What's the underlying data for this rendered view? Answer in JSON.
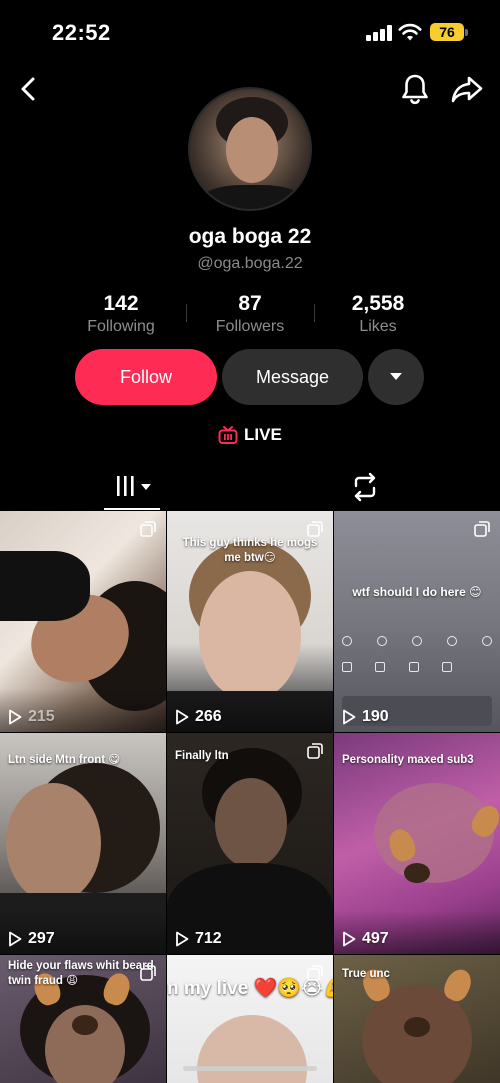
{
  "status_bar": {
    "time": "22:52",
    "battery": "76"
  },
  "header": {
    "back_icon": "chevron-left-icon",
    "bell_icon": "bell-icon",
    "share_icon": "share-arrow-icon"
  },
  "profile": {
    "display_name": "oga boga 22",
    "username": "@oga.boga.22"
  },
  "stats": [
    {
      "value": "142",
      "label": "Following"
    },
    {
      "value": "87",
      "label": "Followers"
    },
    {
      "value": "2,558",
      "label": "Likes"
    }
  ],
  "actions": {
    "follow": "Follow",
    "message": "Message",
    "more_icon": "caret-down-icon"
  },
  "live": {
    "label": "LIVE",
    "icon": "tv-icon"
  },
  "tabs": {
    "videos_icon": "grid-bars-icon",
    "reposts_icon": "repost-icon"
  },
  "videos": [
    {
      "views": "215",
      "caption": ""
    },
    {
      "views": "266",
      "caption": "This guy thinks he mogs me btw😏"
    },
    {
      "views": "190",
      "caption": "wtf should I do here 😊"
    },
    {
      "views": "297",
      "caption": "Ltn side Mtn front 😋"
    },
    {
      "views": "712",
      "caption": "Finally ltn"
    },
    {
      "views": "497",
      "caption": "Personality maxed sub3"
    },
    {
      "views": "",
      "caption": "Hide your flaws whit beard twin fraud 😩"
    },
    {
      "views": "",
      "caption": "n my live ❤️🥺😭💪"
    },
    {
      "views": "",
      "caption": "True unc"
    }
  ],
  "colors": {
    "follow": "#fe2c55",
    "secondary_button": "#2f2f2f",
    "live_accent": "#fe2c55",
    "battery": "#f7ce2c"
  }
}
